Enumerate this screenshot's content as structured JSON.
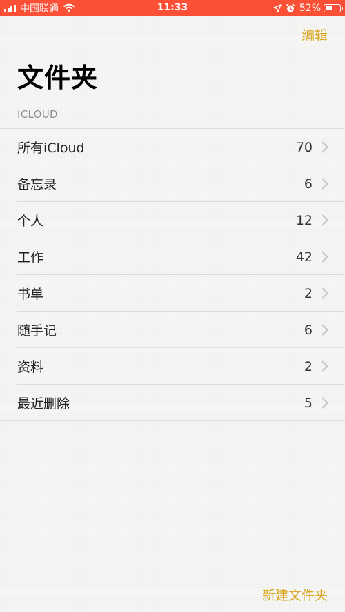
{
  "status_bar": {
    "carrier": "中国联通",
    "time": "11:33",
    "battery_percent_label": "52%",
    "battery_level": 0.52,
    "background_color": "#fb5036",
    "icons": [
      "signal-icon",
      "wifi-icon",
      "location-icon",
      "alarm-icon",
      "battery-icon"
    ]
  },
  "nav": {
    "edit_label": "编辑",
    "accent_color": "#d9a51f"
  },
  "page": {
    "title": "文件夹"
  },
  "section": {
    "header": "ICLOUD"
  },
  "folders": [
    {
      "name": "所有iCloud",
      "count": "70"
    },
    {
      "name": "备忘录",
      "count": "6"
    },
    {
      "name": "个人",
      "count": "12"
    },
    {
      "name": "工作",
      "count": "42"
    },
    {
      "name": "书单",
      "count": "2"
    },
    {
      "name": "随手记",
      "count": "6"
    },
    {
      "name": "资料",
      "count": "2"
    },
    {
      "name": "最近删除",
      "count": "5"
    }
  ],
  "toolbar": {
    "new_folder_label": "新建文件夹"
  }
}
